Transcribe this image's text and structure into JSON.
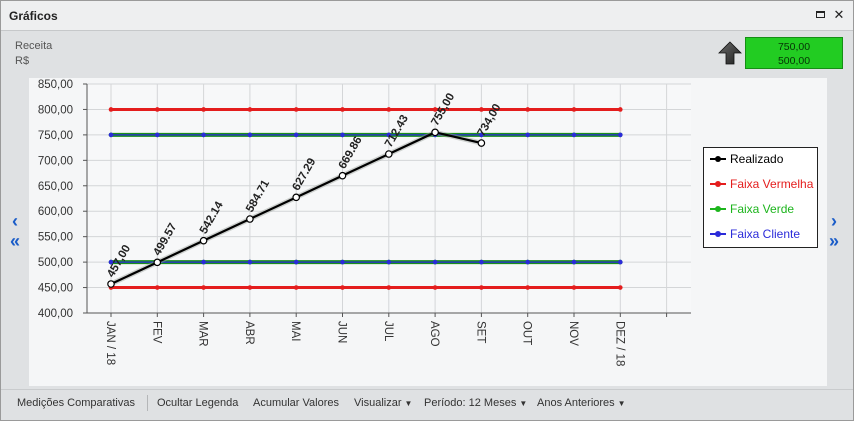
{
  "window": {
    "title": "Gráficos"
  },
  "header": {
    "indicator": "Receita",
    "unit": "R$",
    "target_high": "750,00",
    "target_low": "500,00"
  },
  "colors": {
    "realizado": "#000000",
    "vermelha": "#e41d1d",
    "verde": "#1a8f1a",
    "cliente": "#2b2bd9",
    "target_box": "#22cc22"
  },
  "chart_data": {
    "type": "line",
    "categories": [
      "JAN / 18",
      "FEV",
      "MAR",
      "ABR",
      "MAI",
      "JUN",
      "JUL",
      "AGO",
      "SET",
      "OUT",
      "NOV",
      "DEZ / 18"
    ],
    "ylim": [
      400,
      850
    ],
    "yticks": [
      "400,00",
      "450,00",
      "500,00",
      "550,00",
      "600,00",
      "650,00",
      "700,00",
      "750,00",
      "800,00",
      "850,00"
    ],
    "grid": true,
    "legend_position": "right",
    "series": [
      {
        "name": "Realizado",
        "values": [
          457.0,
          499.57,
          542.14,
          584.71,
          627.29,
          669.86,
          712.43,
          755.0,
          734.0
        ],
        "labels": [
          "457,00",
          "499.57",
          "542.14",
          "584.71",
          "627.29",
          "669.86",
          "712.43",
          "755,00",
          "734,00"
        ]
      },
      {
        "name": "Faixa Vermelha",
        "bands": [
          [
            800,
            800,
            800,
            800,
            800,
            800,
            800,
            800,
            800,
            800,
            800,
            800
          ],
          [
            450,
            450,
            450,
            450,
            450,
            450,
            450,
            450,
            450,
            450,
            450,
            450
          ]
        ]
      },
      {
        "name": "Faixa Verde",
        "bands": [
          [
            750,
            750,
            750,
            750,
            750,
            750,
            750,
            750,
            750,
            750,
            750,
            750
          ],
          [
            500,
            500,
            500,
            500,
            500,
            500,
            500,
            500,
            500,
            500,
            500,
            500
          ]
        ]
      },
      {
        "name": "Faixa Cliente",
        "bands": [
          [
            750,
            750,
            750,
            750,
            750,
            750,
            750,
            750,
            750,
            750,
            750,
            750
          ],
          [
            500,
            500,
            500,
            500,
            500,
            500,
            500,
            500,
            500,
            500,
            500,
            500
          ]
        ]
      }
    ]
  },
  "legend": [
    "Realizado",
    "Faixa Vermelha",
    "Faixa Verde",
    "Faixa Cliente"
  ],
  "nav": {
    "prev": "‹",
    "first": "«",
    "next": "›",
    "last": "»"
  },
  "toolbar": {
    "comparativas": "Medições Comparativas",
    "ocultar": "Ocultar Legenda",
    "acumular": "Acumular Valores",
    "visualizar": "Visualizar",
    "periodo": "Período: 12 Meses",
    "anos": "Anos Anteriores"
  }
}
